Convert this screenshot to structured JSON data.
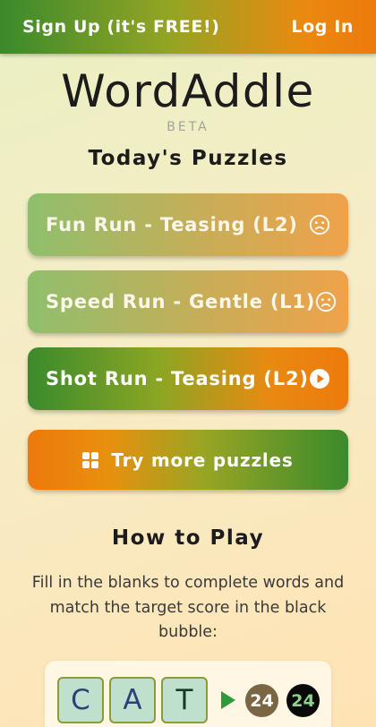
{
  "header": {
    "signup_label": "Sign Up (it's FREE!)",
    "login_label": "Log In"
  },
  "brand": {
    "title": "WordAddle",
    "badge": "BETA"
  },
  "puzzles": {
    "heading": "Today's Puzzles",
    "items": [
      {
        "label": "Fun Run - Teasing (L2)",
        "status_icon": "sad-face-icon"
      },
      {
        "label": "Speed Run - Gentle (L1)",
        "status_icon": "sad-face-icon"
      },
      {
        "label": "Shot Run - Teasing (L2)",
        "status_icon": "play-circle-icon"
      }
    ],
    "more_label": "Try more puzzles"
  },
  "how_to_play": {
    "heading": "How to Play",
    "text": "Fill in the blanks to complete words and match the target score in the black bubble:",
    "example": {
      "letters": [
        "C",
        "A",
        "T"
      ],
      "score": "24",
      "target": "24"
    }
  },
  "colors": {
    "brand_green": "#3a8a2c",
    "brand_orange": "#ee7a0c",
    "target_bubble": "#0a0a0a",
    "score_bubble": "#7a6642"
  }
}
